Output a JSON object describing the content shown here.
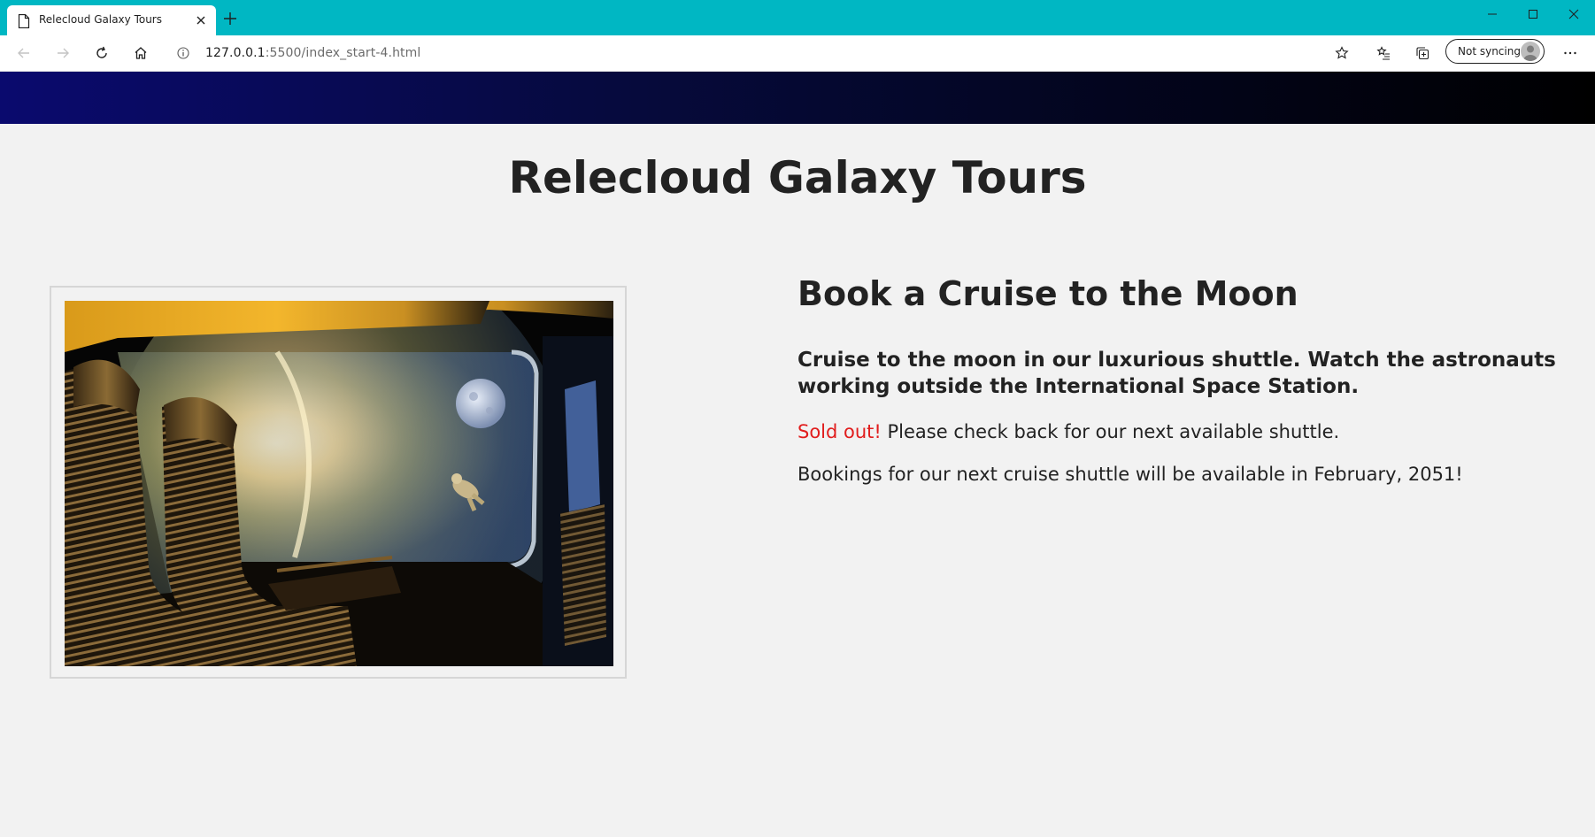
{
  "browser": {
    "tab_title": "Relecloud Galaxy Tours",
    "url_host": "127.0.0.1",
    "url_rest": ":5500/index_start-4.html",
    "sync_label": "Not syncing",
    "accent_color": "#00b7c3",
    "icons": {
      "tab": "page-icon",
      "close": "close-icon",
      "new_tab": "plus-icon",
      "back": "back-arrow-icon",
      "forward": "forward-arrow-icon",
      "refresh": "refresh-icon",
      "home": "home-icon",
      "info": "info-icon",
      "favorite": "star-icon",
      "favorites": "favorites-list-icon",
      "collections": "collections-icon",
      "menu": "more-icon"
    }
  },
  "page": {
    "site_title": "Relecloud Galaxy Tours",
    "heading": "Book a Cruise to the Moon",
    "subheading": "Cruise to the moon in our luxurious shuttle. Watch the astronauts working outside the International Space Station.",
    "sold_out": "Sold out!",
    "sold_out_rest": " Please check back for our next available shuttle.",
    "next_booking": "Bookings for our next cruise shuttle will be available in February, 2051!",
    "sold_out_color": "#e11d1d",
    "band_colors": [
      "#0a0a6e",
      "#000000"
    ]
  }
}
